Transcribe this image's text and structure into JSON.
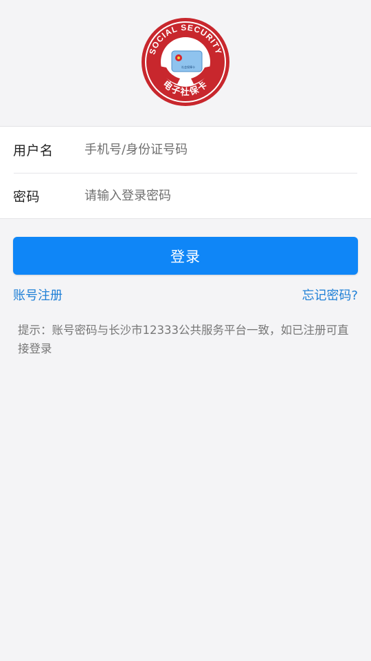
{
  "logo": {
    "arc_text": "SOCIAL SECURITY",
    "bottom_text": "电子社保卡",
    "card_text": "社会保障卡",
    "ring_color": "#c8272d"
  },
  "form": {
    "username": {
      "label": "用户名",
      "placeholder": "手机号/身份证号码",
      "value": ""
    },
    "password": {
      "label": "密码",
      "placeholder": "请输入登录密码",
      "value": ""
    }
  },
  "login_button": {
    "label": "登录",
    "color": "#0f86f7"
  },
  "links": {
    "register": "账号注册",
    "forgot": "忘记密码?"
  },
  "hint": "提示：账号密码与长沙市12333公共服务平台一致，如已注册可直接登录"
}
